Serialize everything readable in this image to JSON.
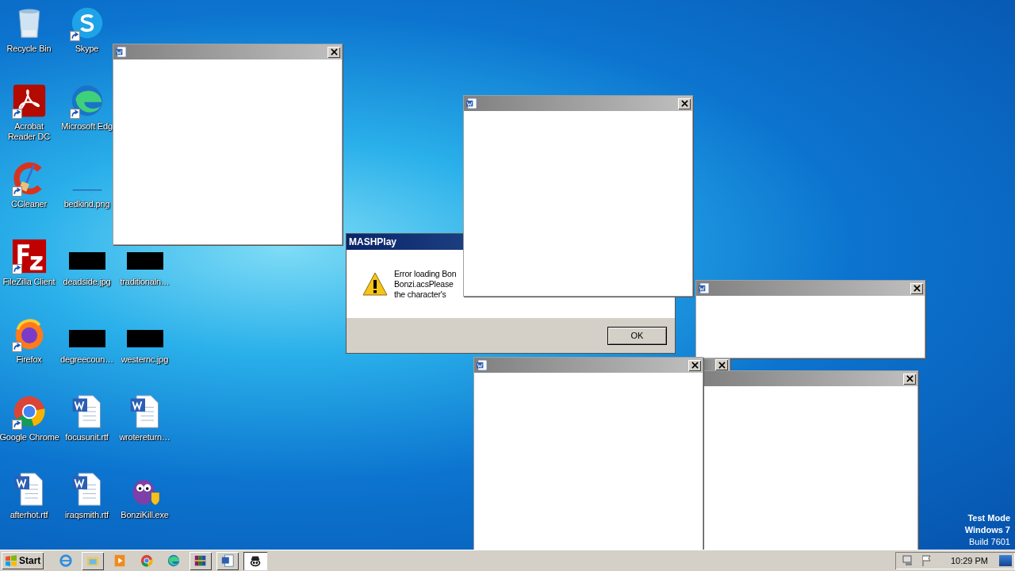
{
  "desktop_icons": [
    [
      {
        "kind": "recycle",
        "label": "Recycle Bin",
        "shortcut": false
      },
      {
        "kind": "acrobat",
        "label": "Acrobat Reader DC",
        "shortcut": true
      },
      {
        "kind": "ccleaner",
        "label": "CCleaner",
        "shortcut": true
      },
      {
        "kind": "filezilla",
        "label": "FileZilla Client",
        "shortcut": true
      },
      {
        "kind": "firefox",
        "label": "Firefox",
        "shortcut": true
      },
      {
        "kind": "chrome",
        "label": "Google Chrome",
        "shortcut": true
      },
      {
        "kind": "word",
        "label": "afterhot.rtf",
        "shortcut": false
      }
    ],
    [
      {
        "kind": "skype",
        "label": "Skype",
        "shortcut": true
      },
      {
        "kind": "edge",
        "label": "Microsoft Edg",
        "shortcut": true
      },
      {
        "kind": "blank",
        "label": "bedkind.png",
        "shortcut": false
      },
      {
        "kind": "dark",
        "label": "deadside.jpg",
        "shortcut": false
      },
      {
        "kind": "dark",
        "label": "degreecoun…",
        "shortcut": false
      },
      {
        "kind": "word",
        "label": "focusunit.rtf",
        "shortcut": false
      },
      {
        "kind": "word",
        "label": "iraqsmith.rtf",
        "shortcut": false
      }
    ],
    [
      {
        "kind": "dark",
        "label": "traditionaln…",
        "shortcut": false
      },
      {
        "kind": "dark",
        "label": "westernc.jpg",
        "shortcut": false
      },
      {
        "kind": "word",
        "label": "wrotereturn…",
        "shortcut": false
      },
      {
        "kind": "bonzi",
        "label": "BonziKill.exe",
        "shortcut": false
      }
    ]
  ],
  "dialog": {
    "title": "MASHPlay",
    "lines": [
      "Error loading Bon",
      "Bonzi.acsPlease",
      "the character's"
    ],
    "button": "OK"
  },
  "document_windows": [
    {
      "show_icon": true
    },
    {
      "show_icon": true
    },
    {
      "show_icon": true
    },
    {
      "show_icon": false
    },
    {
      "show_icon": false
    },
    {
      "show_icon": true
    }
  ],
  "system_text": [
    "Test Mode",
    "Windows 7",
    "Build 7601"
  ],
  "taskbar": {
    "start": "Start",
    "items": [
      {
        "kind": "ie",
        "selected": false
      },
      {
        "kind": "explorer",
        "selected": false
      },
      {
        "kind": "media",
        "selected": false
      },
      {
        "kind": "chrome",
        "selected": false
      },
      {
        "kind": "edge",
        "selected": false
      },
      {
        "kind": "winrar",
        "selected": false
      },
      {
        "kind": "word",
        "selected": false
      },
      {
        "kind": "bonzi",
        "selected": true
      }
    ],
    "clock": "10:29 PM"
  }
}
